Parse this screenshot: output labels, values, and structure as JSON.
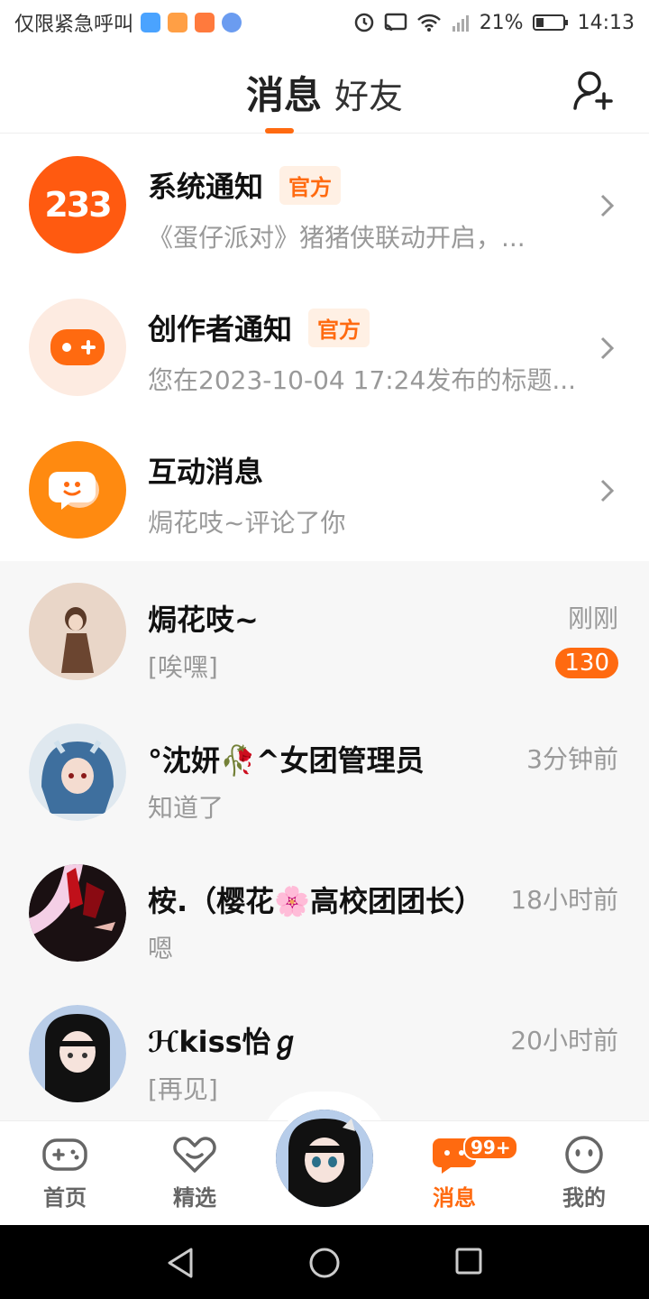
{
  "status_bar": {
    "carrier_text": "仅限紧急呼叫",
    "battery": "21%",
    "time": "14:13",
    "icons": [
      "shield-app-icon",
      "video-app-icon",
      "game-app-icon",
      "browser-app-icon",
      "alarm-icon",
      "cast-icon",
      "wifi-icon",
      "signal-icon",
      "battery-icon"
    ]
  },
  "header": {
    "tabs": [
      {
        "label": "消息",
        "active": true
      },
      {
        "label": "好友",
        "active": false
      }
    ],
    "add_friend_icon": "add-friend-icon"
  },
  "notifications": [
    {
      "title": "系统通知",
      "badge": "官方",
      "subtitle": "《蛋仔派对》猪猪侠联动开启，...",
      "icon": "233-logo-icon",
      "avatar_text": "233"
    },
    {
      "title": "创作者通知",
      "badge": "官方",
      "subtitle": "您在2023-10-04 17:24发布的标题...",
      "icon": "gamepad-icon"
    },
    {
      "title": "互动消息",
      "badge": "",
      "subtitle": "焗花吱~评论了你",
      "icon": "chat-bubble-icon"
    }
  ],
  "chats": [
    {
      "name": "焗花吱~",
      "message": "[唉嘿]",
      "time": "刚刚",
      "unread": "130"
    },
    {
      "name": "°沈妍🥀^女团管理员",
      "message": "知道了",
      "time": "3分钟前",
      "unread": ""
    },
    {
      "name": "桉.（樱花🌸高校团团长）",
      "message": "嗯",
      "time": "18小时前",
      "unread": ""
    },
    {
      "name": "ℋkiss怡ℊ",
      "message": "[再见]",
      "time": "20小时前",
      "unread": ""
    }
  ],
  "bottom_nav": {
    "items": [
      {
        "label": "首页",
        "icon": "gamepad-icon",
        "active": false
      },
      {
        "label": "精选",
        "icon": "heart-icon",
        "active": false
      },
      {
        "label": "消息",
        "icon": "message-icon",
        "active": true,
        "badge": "99+"
      },
      {
        "label": "我的",
        "icon": "profile-face-icon",
        "active": false
      }
    ]
  },
  "colors": {
    "accent": "#ff6a10",
    "secondary_text": "#999999",
    "chat_background": "#f7f7f7"
  }
}
